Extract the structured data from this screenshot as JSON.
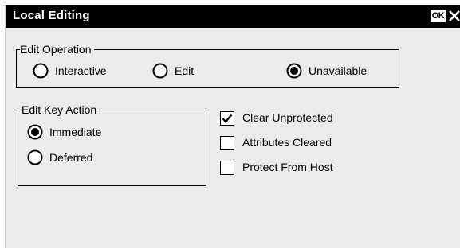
{
  "window": {
    "title": "Local Editing",
    "ok_label": "OK",
    "close_icon": "close-icon"
  },
  "edit_operation": {
    "legend": "Edit Operation",
    "options": [
      {
        "label": "Interactive",
        "selected": false
      },
      {
        "label": "Edit",
        "selected": false
      },
      {
        "label": "Unavailable",
        "selected": true
      }
    ]
  },
  "edit_key_action": {
    "legend": "Edit Key Action",
    "options": [
      {
        "label": "Immediate",
        "selected": true
      },
      {
        "label": "Deferred",
        "selected": false
      }
    ]
  },
  "checkboxes": [
    {
      "label": "Clear Unprotected",
      "checked": true
    },
    {
      "label": "Attributes Cleared",
      "checked": false
    },
    {
      "label": "Protect From Host",
      "checked": false
    }
  ],
  "colors": {
    "titlebar": "#000000",
    "background": "#ebebeb",
    "text": "#000000"
  }
}
